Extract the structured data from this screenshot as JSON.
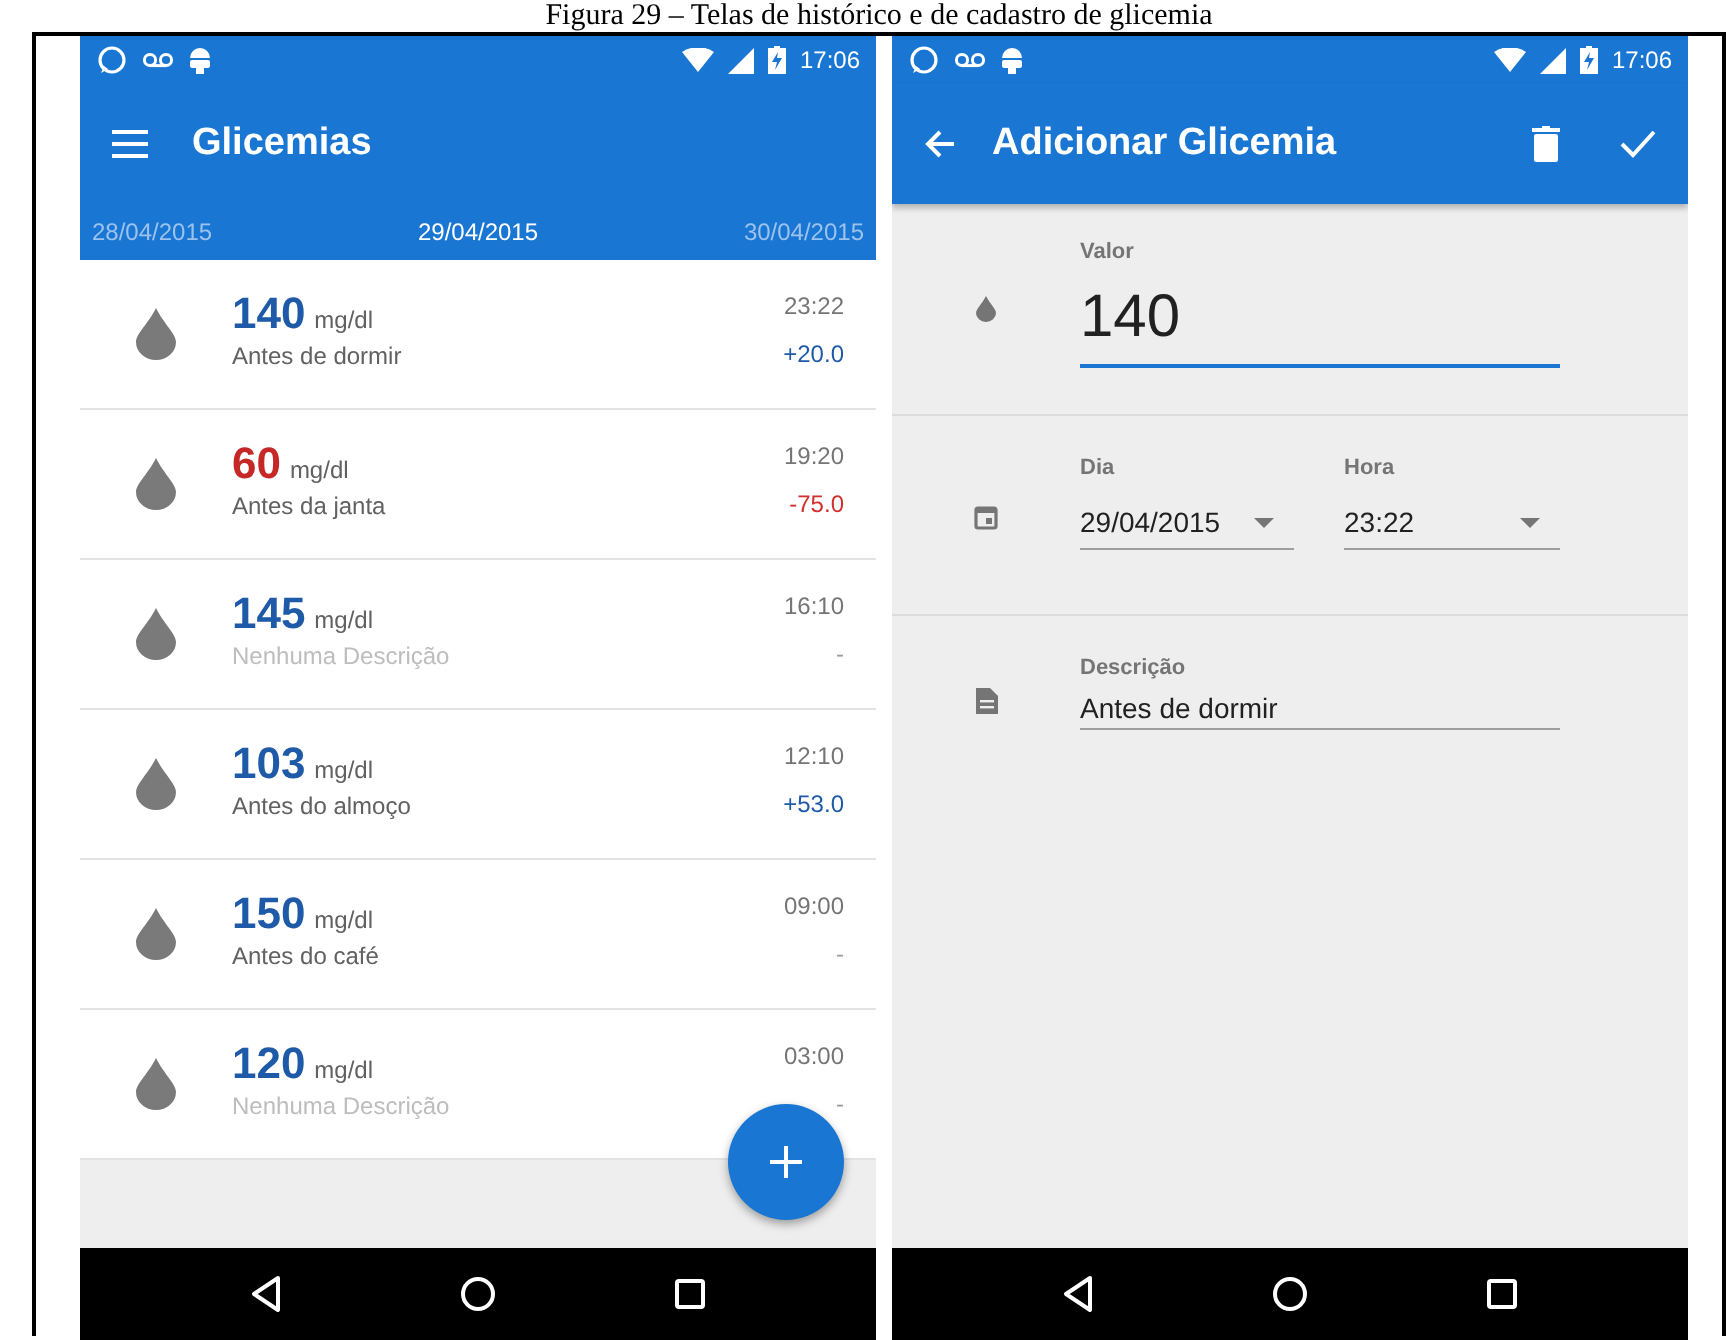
{
  "caption": "Figura 29 – Telas de histórico e de cadastro de glicemia",
  "list_screen": {
    "status_bar": {
      "time": "17:06"
    },
    "app_bar": {
      "title": "Glicemias"
    },
    "date_tabs": [
      {
        "label": "28/04/2015",
        "selected": false
      },
      {
        "label": "29/04/2015",
        "selected": true
      },
      {
        "label": "30/04/2015",
        "selected": false
      }
    ],
    "readings": [
      {
        "value": "140",
        "unit": "mg/dl",
        "description": "Antes de dormir",
        "empty": false,
        "alert": false,
        "time": "23:22",
        "delta": "+20.0",
        "kind": "rise"
      },
      {
        "value": "60",
        "unit": "mg/dl",
        "description": "Antes da janta",
        "empty": false,
        "alert": true,
        "time": "19:20",
        "delta": "-75.0",
        "kind": "fall"
      },
      {
        "value": "145",
        "unit": "mg/dl",
        "description": "Nenhuma Descrição",
        "empty": true,
        "alert": false,
        "time": "16:10",
        "delta": "-",
        "kind": "none"
      },
      {
        "value": "103",
        "unit": "mg/dl",
        "description": "Antes do almoço",
        "empty": false,
        "alert": false,
        "time": "12:10",
        "delta": "+53.0",
        "kind": "rise"
      },
      {
        "value": "150",
        "unit": "mg/dl",
        "description": "Antes do café",
        "empty": false,
        "alert": false,
        "time": "09:00",
        "delta": "-",
        "kind": "none"
      },
      {
        "value": "120",
        "unit": "mg/dl",
        "description": "Nenhuma Descrição",
        "empty": true,
        "alert": false,
        "time": "03:00",
        "delta": "-",
        "kind": "none"
      }
    ]
  },
  "form_screen": {
    "status_bar": {
      "time": "17:06"
    },
    "app_bar": {
      "title": "Adicionar Glicemia"
    },
    "value_field": {
      "label": "Valor",
      "value": "140",
      "focused": true
    },
    "day_field": {
      "label": "Dia",
      "value": "29/04/2015",
      "focused": false
    },
    "hour_field": {
      "label": "Hora",
      "value": "23:22",
      "focused": false
    },
    "description_field": {
      "label": "Descrição",
      "value": "Antes de dormir",
      "focused": false
    }
  }
}
